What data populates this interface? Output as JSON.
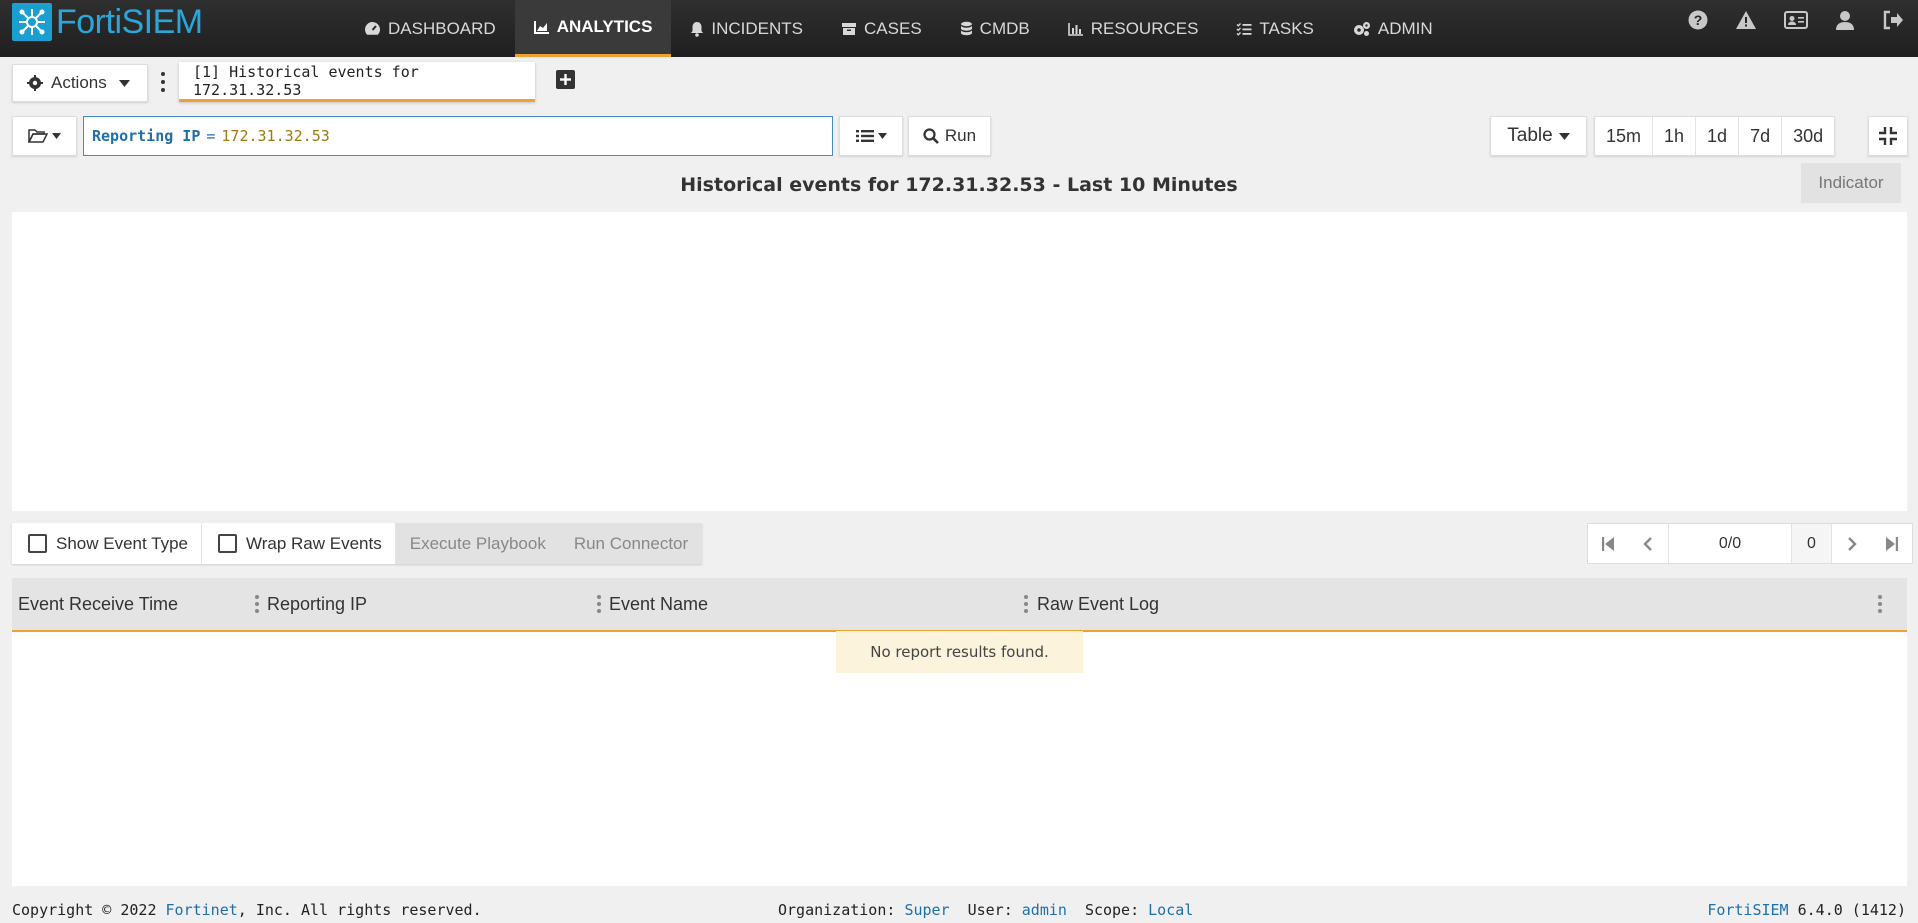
{
  "app": {
    "logo_text": "FortiSIEM"
  },
  "nav": {
    "items": [
      {
        "label": "DASHBOARD",
        "icon": "dashboard-icon"
      },
      {
        "label": "ANALYTICS",
        "icon": "area-chart-icon",
        "active": true
      },
      {
        "label": "INCIDENTS",
        "icon": "bell-icon"
      },
      {
        "label": "CASES",
        "icon": "archive-icon"
      },
      {
        "label": "CMDB",
        "icon": "database-icon"
      },
      {
        "label": "RESOURCES",
        "icon": "bar-chart-icon"
      },
      {
        "label": "TASKS",
        "icon": "tasks-icon"
      },
      {
        "label": "ADMIN",
        "icon": "gears-icon"
      }
    ],
    "right_icons": [
      "help-icon",
      "warning-icon",
      "id-card-icon",
      "user-icon",
      "sign-out-icon"
    ]
  },
  "toolbar": {
    "actions_label": "Actions",
    "query_tab_label": "[1] Historical events for 172.31.32.53"
  },
  "query": {
    "attribute": "Reporting IP",
    "operator": "=",
    "value": "172.31.32.53",
    "run_label": "Run",
    "view_label": "Table",
    "ranges": [
      "15m",
      "1h",
      "1d",
      "7d",
      "30d"
    ]
  },
  "report": {
    "title": "Historical events for 172.31.32.53 - Last 10 Minutes",
    "indicator_label": "Indicator"
  },
  "results_toolbar": {
    "show_event_type": "Show Event Type",
    "wrap_raw_events": "Wrap Raw Events",
    "execute_playbook": "Execute Playbook",
    "run_connector": "Run Connector"
  },
  "pager": {
    "page": "0/0",
    "count": "0"
  },
  "table": {
    "columns": [
      "Event Receive Time",
      "Reporting IP",
      "Event Name",
      "Raw Event Log"
    ],
    "empty_message": "No report results found."
  },
  "footer": {
    "copyright_prefix": "Copyright © 2022 ",
    "company": "Fortinet",
    "copyright_suffix": ", Inc. All rights reserved.",
    "org_label": "Organization:",
    "org_value": "Super",
    "user_label": "User:",
    "user_value": "admin",
    "scope_label": "Scope:",
    "scope_value": "Local",
    "product": "FortiSIEM",
    "version": " 6.4.0 (1412)"
  },
  "colors": {
    "nav_bg": "#252525",
    "accent": "#f0a030",
    "brand": "#2aa7da",
    "link": "#1f6fa8"
  }
}
